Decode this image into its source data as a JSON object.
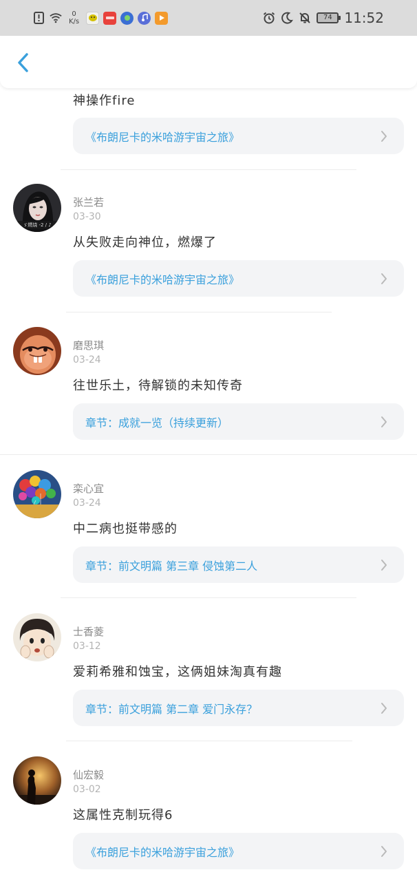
{
  "status_bar": {
    "speed_value": "0",
    "speed_unit": "K/s",
    "battery": "74",
    "time": "11:52",
    "icons": [
      "alert-icon",
      "wifi-icon",
      "alarm-icon",
      "moon-icon",
      "mute-bell-icon"
    ]
  },
  "header": {
    "back_icon": "chevron-left-icon"
  },
  "first": {
    "text": "神操作fire",
    "link": "《布朗尼卡的米哈游宇宙之旅》"
  },
  "comments": [
    {
      "name": "张兰若",
      "date": "03-30",
      "text": "从失败走向神位，燃爆了",
      "link": "《布朗尼卡的米哈游宇宙之旅》",
      "avatar_label": "ゞ燃烧 -2 / ♪"
    },
    {
      "name": "磨思琪",
      "date": "03-24",
      "text": "往世乐土，待解锁的未知传奇",
      "link": "章节：成就一览（持续更新）"
    },
    {
      "name": "栾心宜",
      "date": "03-24",
      "text": "中二病也挺带感的",
      "link": "章节：前文明篇 第三章 侵蚀第二人"
    },
    {
      "name": "士香菱",
      "date": "03-12",
      "text": "爱莉希雅和蚀宝，这俩姐妹淘真有趣",
      "link": "章节：前文明篇 第二章 爱门永存？"
    },
    {
      "name": "仙宏毅",
      "date": "03-02",
      "text": "这属性克制玩得6",
      "link": "《布朗尼卡的米哈游宇宙之旅》"
    }
  ],
  "colors": {
    "link": "#3aa0dc",
    "back": "#3aa0dc",
    "card": "#f3f4f6",
    "status_bar": "#dcdcdc"
  }
}
